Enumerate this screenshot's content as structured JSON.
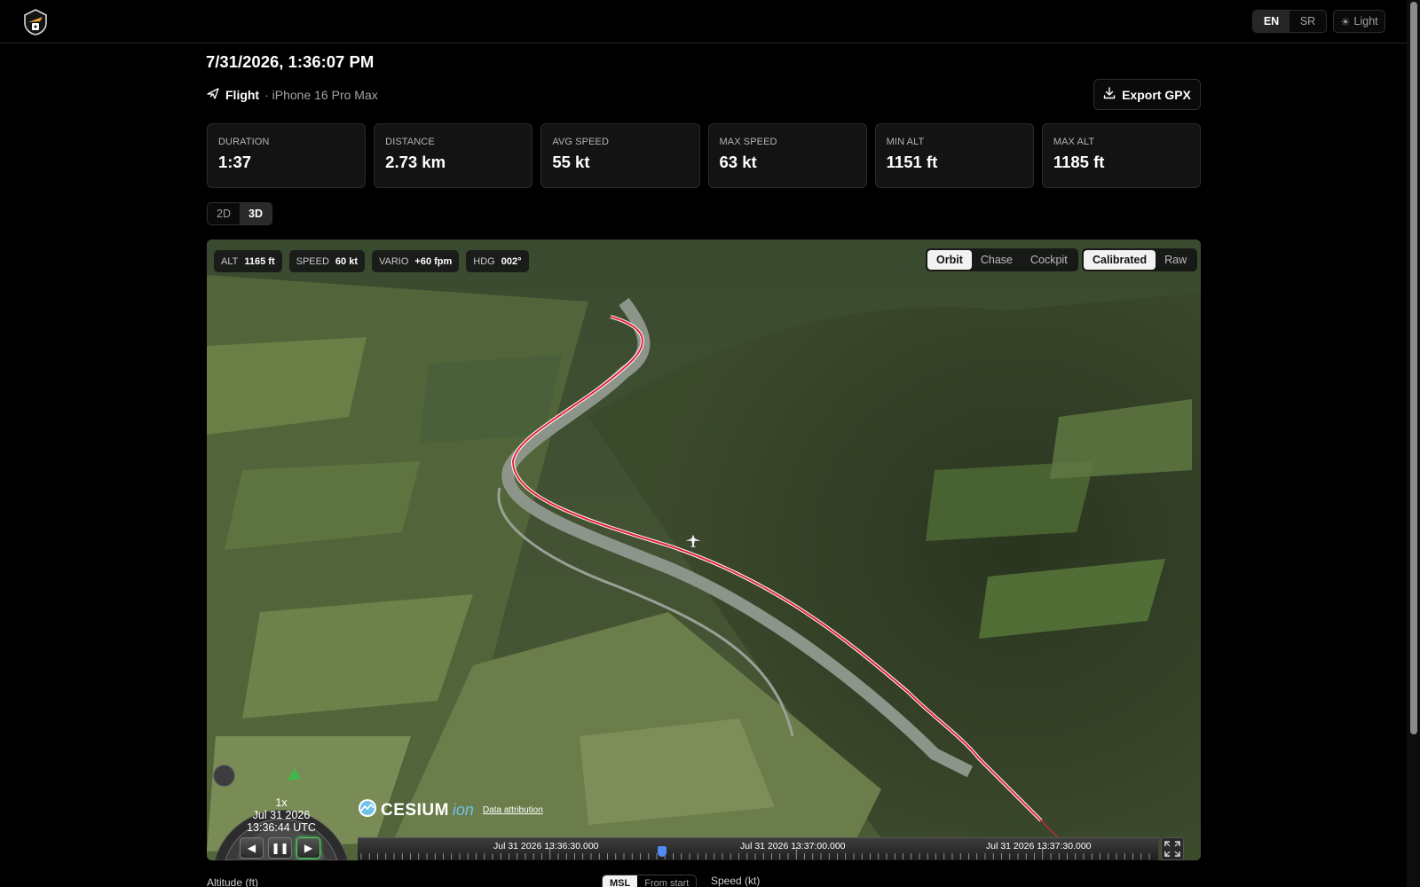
{
  "header": {
    "theme_label": "Light",
    "languages": [
      {
        "label": "EN",
        "active": true
      },
      {
        "label": "SR",
        "active": false
      }
    ]
  },
  "track": {
    "title": "7/31/2026, 1:36:07 PM",
    "kind": "Flight",
    "device": "· iPhone 16 Pro Max",
    "export_label": "Export GPX"
  },
  "stats": [
    {
      "label": "DURATION",
      "value": "1:37"
    },
    {
      "label": "DISTANCE",
      "value": "2.73 km"
    },
    {
      "label": "AVG SPEED",
      "value": "55 kt"
    },
    {
      "label": "MAX SPEED",
      "value": "63 kt"
    },
    {
      "label": "MIN ALT",
      "value": "1151 ft"
    },
    {
      "label": "MAX ALT",
      "value": "1185 ft"
    }
  ],
  "view_modes": [
    {
      "label": "2D",
      "active": false
    },
    {
      "label": "3D",
      "active": true
    }
  ],
  "hud": [
    {
      "label": "ALT",
      "value": "1165 ft"
    },
    {
      "label": "SPEED",
      "value": "60 kt"
    },
    {
      "label": "VARIO",
      "value": "+60 fpm"
    },
    {
      "label": "HDG",
      "value": "002°"
    }
  ],
  "camera_modes": [
    {
      "label": "Orbit",
      "active": true
    },
    {
      "label": "Chase",
      "active": false
    },
    {
      "label": "Cockpit",
      "active": false
    }
  ],
  "altitude_source": [
    {
      "label": "Calibrated",
      "active": true
    },
    {
      "label": "Raw",
      "active": false
    }
  ],
  "animation": {
    "speed": "1x",
    "date": "Jul 31 2026",
    "time": "13:36:44 UTC"
  },
  "cesium": {
    "brand": "CESIUM",
    "suffix": "ion",
    "attribution": "Data attribution"
  },
  "timeline": {
    "labels": [
      "Jul 31 2026 13:36:30.000",
      "Jul 31 2026 13:37:00.000",
      "Jul 31 2026 13:37:30.000"
    ],
    "progress": 0.38
  },
  "charts": {
    "altitude_label": "Altitude (ft)",
    "speed_label": "Speed (kt)",
    "altitude_ref": [
      {
        "label": "MSL",
        "active": true
      },
      {
        "label": "From start",
        "active": false
      }
    ]
  },
  "colors": {
    "track_line": "#e0253a",
    "accent_green": "#4cd15c"
  }
}
